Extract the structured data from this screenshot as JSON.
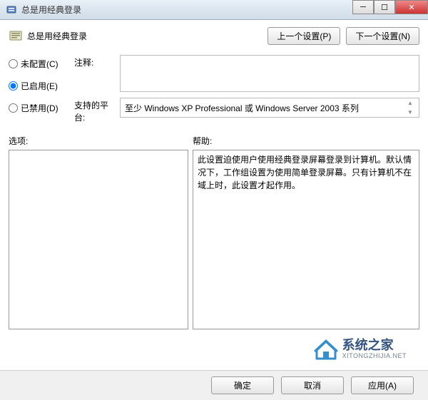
{
  "window": {
    "title": "总是用经典登录"
  },
  "header": {
    "policy_title": "总是用经典登录",
    "prev_button": "上一个设置(P)",
    "next_button": "下一个设置(N)"
  },
  "radios": {
    "not_configured": "未配置(C)",
    "enabled": "已启用(E)",
    "disabled": "已禁用(D)",
    "selected": "enabled"
  },
  "fields": {
    "comment_label": "注释:",
    "comment_value": "",
    "platform_label": "支持的平台:",
    "platform_value": "至少 Windows XP Professional 或 Windows Server 2003 系列"
  },
  "panes": {
    "options_label": "选项:",
    "help_label": "帮助:",
    "help_text": "此设置迫使用户使用经典登录屏幕登录到计算机。默认情况下，工作组设置为使用简单登录屏幕。只有计算机不在域上时，此设置才起作用。"
  },
  "footer": {
    "ok": "确定",
    "cancel": "取消",
    "apply": "应用(A)"
  },
  "watermark": {
    "name": "系统之家",
    "url": "XITONGZHIJIA.NET"
  }
}
